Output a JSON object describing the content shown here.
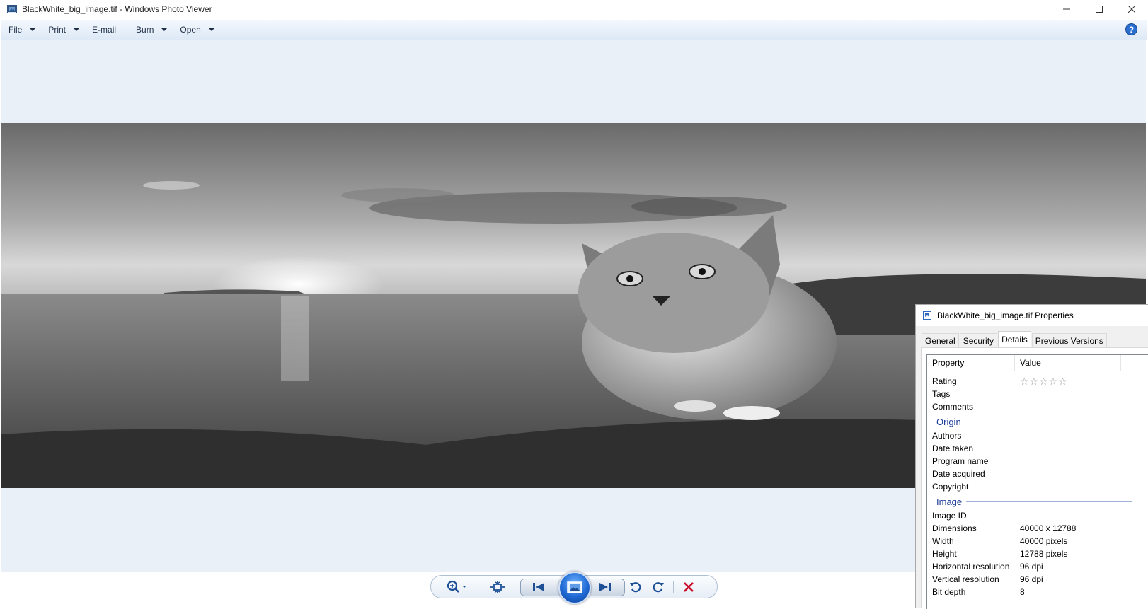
{
  "window": {
    "title": "BlackWhite_big_image.tif - Windows Photo Viewer"
  },
  "menu": {
    "items": [
      "File",
      "Print",
      "E-mail",
      "Burn",
      "Open"
    ]
  },
  "controls": {
    "zoom": "zoom-icon",
    "actual_size": "actual-size-icon",
    "previous": "previous-icon",
    "slideshow": "slideshow-icon",
    "next": "next-icon",
    "rotate_ccw": "rotate-counterclockwise-icon",
    "rotate_cw": "rotate-clockwise-icon",
    "delete": "delete-icon"
  },
  "properties": {
    "title": "BlackWhite_big_image.tif Properties",
    "tabs": [
      "General",
      "Security",
      "Details",
      "Previous Versions"
    ],
    "active_tab": "Details",
    "columns": [
      "Property",
      "Value"
    ],
    "rows_top": [
      {
        "k": "Rating",
        "v": "☆☆☆☆☆"
      },
      {
        "k": "Tags",
        "v": ""
      },
      {
        "k": "Comments",
        "v": ""
      }
    ],
    "origin_label": "Origin",
    "origin_rows": [
      {
        "k": "Authors",
        "v": ""
      },
      {
        "k": "Date taken",
        "v": ""
      },
      {
        "k": "Program name",
        "v": ""
      },
      {
        "k": "Date acquired",
        "v": ""
      },
      {
        "k": "Copyright",
        "v": ""
      }
    ],
    "image_label": "Image",
    "image_rows": [
      {
        "k": "Image ID",
        "v": ""
      },
      {
        "k": "Dimensions",
        "v": "40000 x 12788"
      },
      {
        "k": "Width",
        "v": "40000 pixels"
      },
      {
        "k": "Height",
        "v": "12788 pixels"
      },
      {
        "k": "Horizontal resolution",
        "v": "96 dpi"
      },
      {
        "k": "Vertical resolution",
        "v": "96 dpi"
      },
      {
        "k": "Bit depth",
        "v": "8"
      }
    ]
  },
  "colors": {
    "viewer_bg": "#eaf0f8",
    "accent": "#1f69d4",
    "delete": "#c8102e"
  }
}
